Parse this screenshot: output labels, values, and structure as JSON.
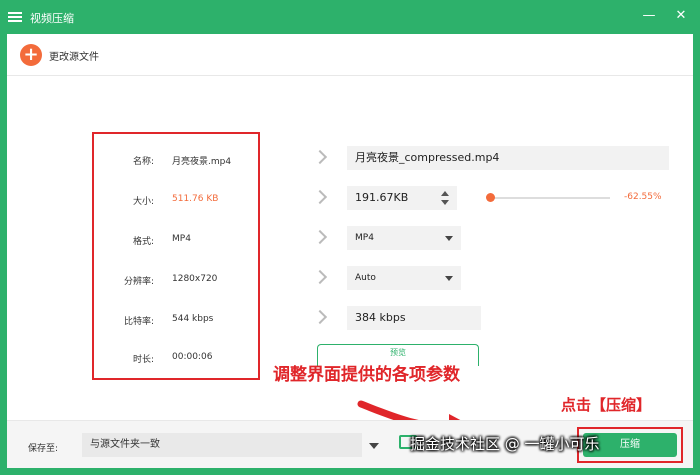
{
  "window": {
    "title": "视频压缩",
    "minimize": "—",
    "close": "✕"
  },
  "toolbar": {
    "add_icon": "+",
    "change_source_label": "更改源文件"
  },
  "source_info": {
    "rows": [
      {
        "key": "名称:",
        "value": "月亮夜景.mp4"
      },
      {
        "key": "大小:",
        "value": "511.76 KB"
      },
      {
        "key": "格式:",
        "value": "MP4"
      },
      {
        "key": "分辨率:",
        "value": "1280x720"
      },
      {
        "key": "比特率:",
        "value": "544 kbps"
      },
      {
        "key": "时长:",
        "value": "00:00:06"
      }
    ]
  },
  "output": {
    "name": "月亮夜景_compressed.mp4",
    "size": "191.67KB",
    "size_slider_percent": "-62.55%",
    "format": "MP4",
    "resolution": "Auto",
    "bitrate": "384 kbps",
    "preview_label": "预览"
  },
  "annotations": {
    "adjust_params": "调整界面提供的各项参数",
    "click_compress": "点击【压缩】"
  },
  "bottom": {
    "save_to_label": "保存至:",
    "save_to_value": "与源文件夹一致",
    "compress_label": "压缩"
  },
  "watermark": "掘金技术社区 @ 一罐小可乐",
  "colors": {
    "brand_green": "#2db16b",
    "accent_orange": "#f36b3b",
    "annotation_red": "#e0262a"
  },
  "icons": {
    "app_logo": "sliders-icon",
    "add": "plus-circle-icon",
    "chevron": "chevron-right-icon",
    "folder": "folder-icon"
  }
}
